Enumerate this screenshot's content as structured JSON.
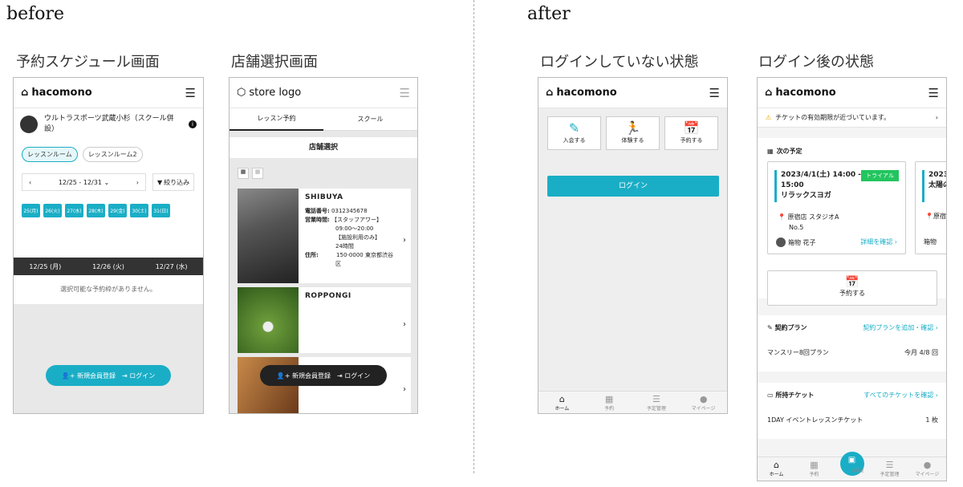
{
  "labels": {
    "before": "before",
    "after": "after"
  },
  "sections": {
    "schedule": "予約スケジュール画面",
    "store_select": "店舗選択画面",
    "logged_out": "ログインしていない状態",
    "logged_in": "ログイン後の状態"
  },
  "brand": {
    "logo": "hacomono",
    "store_logo": "store logo",
    "accent": "#1aaec6"
  },
  "schedule": {
    "studio": "ウルトラスポーツ武蔵小杉（スクール併設）",
    "rooms": [
      "レッスンルーム",
      "レッスンルーム2"
    ],
    "range": "12/25 - 12/31",
    "filter": "絞り込み",
    "days": [
      "25(月)",
      "26(火)",
      "27(水)",
      "28(木)",
      "29(金)",
      "30(土)",
      "31(日)"
    ],
    "cols": [
      "12/25 (月)",
      "12/26 (火)",
      "12/27 (水)"
    ],
    "empty": "選択可能な予約枠がありません。",
    "register": "新規会員登録",
    "login": "ログイン"
  },
  "store": {
    "tabs": [
      "レッスン予約",
      "スクール"
    ],
    "heading": "店舗選択",
    "stores": [
      {
        "name": "SHIBUYA",
        "l1": "電話番号:",
        "v1": "0312345678",
        "l2": "営業時間:",
        "v2a": "【スタッフアワー】",
        "v2b": "09:00〜20:00",
        "v2c": "【施設利用のみ】",
        "v2d": "24時間",
        "l3": "住所:",
        "v3a": "150-0000 東京都渋谷",
        "v3b": "区"
      },
      {
        "name": "ROPPONGI"
      }
    ],
    "register": "新規会員登録",
    "login": "ログイン"
  },
  "loggedout": {
    "tiles": [
      "入会する",
      "体験する",
      "予約する"
    ],
    "login": "ログイン",
    "nav": [
      "ホーム",
      "予約",
      "予定管理",
      "マイページ"
    ]
  },
  "loggedin": {
    "notice": "チケットの有効期限が近づいています。",
    "next": "次の予定",
    "event": {
      "date": "2023/4/1(土) 14:00 - 15:00",
      "title": "リラックスヨガ",
      "badge": "トライアル",
      "place": "原宿店 スタジオA",
      "room": "No.5",
      "staff": "箱物 花子",
      "detail": "詳細を確認"
    },
    "event2": {
      "date": "2023",
      "title": "太陽の",
      "place": "原宿",
      "staff": "箱物"
    },
    "reserve": "予約する",
    "plan": {
      "title": "契約プラン",
      "link": "契約プランを追加・確認",
      "name": "マンスリー8回プラン",
      "count": "今月 4/8 回"
    },
    "ticket": {
      "title": "所持チケット",
      "link": "すべてのチケットを確認",
      "name": "1DAY イベントレッスンチケット",
      "count": "1 枚"
    },
    "nav": [
      "ホーム",
      "予約",
      "会員証",
      "予定管理",
      "マイページ"
    ]
  }
}
